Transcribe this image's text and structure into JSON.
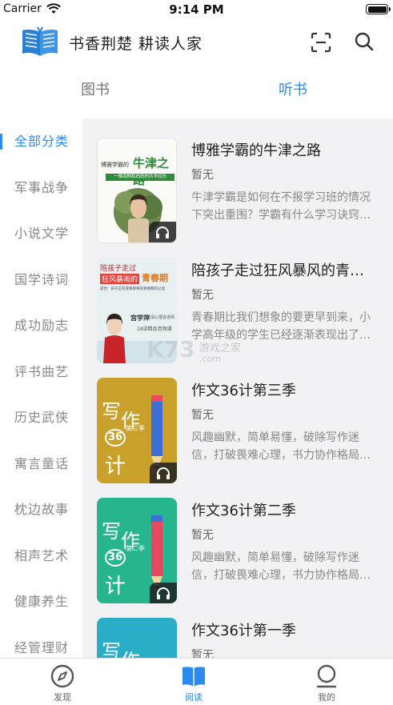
{
  "status": {
    "carrier": "Carrier",
    "time": "9:14 PM",
    "battery_level": 1.0
  },
  "header": {
    "title": "书香荆楚 耕读人家",
    "logo_icon": "open-book-icon",
    "scan_icon": "scan-icon",
    "search_icon": "search-icon"
  },
  "tabs": [
    {
      "label": "图书",
      "active": false
    },
    {
      "label": "听书",
      "active": true
    }
  ],
  "sidebar": {
    "items": [
      {
        "label": "全部分类",
        "active": true
      },
      {
        "label": "军事战争"
      },
      {
        "label": "小说文学"
      },
      {
        "label": "国学诗词"
      },
      {
        "label": "成功励志"
      },
      {
        "label": "评书曲艺"
      },
      {
        "label": "历史武侠"
      },
      {
        "label": "寓言童话"
      },
      {
        "label": "枕边故事"
      },
      {
        "label": "相声艺术"
      },
      {
        "label": "健康养生"
      },
      {
        "label": "经管理财"
      }
    ]
  },
  "list": {
    "items": [
      {
        "title": "博雅学霸的牛津之路",
        "author": "暂无",
        "desc": "牛津学霸是如何在不报学习班的情况下突出重围？学霸有什么学习诀窍…",
        "cover": {
          "line1": "博雅学霸的",
          "line2": "牛津之路",
          "sub": "一推南桐和妈妈的共学经历"
        }
      },
      {
        "title": "陪孩子走过狂风暴风的青…",
        "author": "暂无",
        "desc": "青春期比我们想象的要更早到来，小学高年级的学生已经逐渐表现出了…",
        "cover": {
          "line1": "陪孩子走过",
          "line2": "狂风暴雨的",
          "line3": "青春期",
          "sub": "适合：孩子正在或将即将的青春期的父母",
          "name": "宫学萍",
          "name_sub": "资深心理咨询师",
          "episodes": "18讲精品音频课"
        }
      },
      {
        "title": "作文36计第三季",
        "author": "暂无",
        "desc": "风趣幽默，简单易懂，破除写作迷信，打破畏难心理，书力协作格局…",
        "cover": {
          "t1": "写",
          "t2": "作",
          "num": "36",
          "t3": "计",
          "season": "第三季",
          "bg": "#c9a12a"
        }
      },
      {
        "title": "作文36计第二季",
        "author": "暂无",
        "desc": "风趣幽默，简单易懂，破除写作迷信，打破畏难心理，书力协作格局…",
        "cover": {
          "t1": "写",
          "t2": "作",
          "num": "36",
          "t3": "计",
          "season": "第二季",
          "bg": "#27b58e"
        }
      },
      {
        "title": "作文36计第一季",
        "author": "暂无",
        "desc": "",
        "cover": {
          "t1": "写",
          "t2": "作",
          "bg": "#2aaec8"
        }
      }
    ]
  },
  "watermark": {
    "text": "游戏之家",
    "sub": ".com",
    "logo": "K73"
  },
  "tabbar": [
    {
      "label": "发现",
      "icon": "compass-icon",
      "active": false
    },
    {
      "label": "阅读",
      "icon": "book-icon",
      "active": true
    },
    {
      "label": "我的",
      "icon": "user-icon",
      "active": false
    }
  ],
  "colors": {
    "accent": "#2a8af0",
    "content_bg": "#f2f2f4"
  }
}
